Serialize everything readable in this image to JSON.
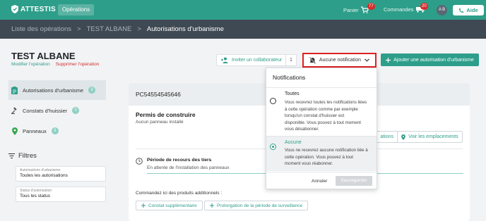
{
  "topbar": {
    "logo_text": "ATTESTIS",
    "nav_active": "Opérations",
    "cart_label": "Panier",
    "cart_count": "77",
    "orders_label": "Commandes",
    "orders_count": "20",
    "avatar_initials": "A B",
    "help_label": "Aide"
  },
  "breadcrumb": {
    "items": [
      "Liste des opérations",
      "TEST ALBANE",
      "Autorisations d'urbanisme"
    ],
    "separator": ">"
  },
  "header": {
    "title": "TEST ALBANE",
    "edit_link": "Modifier l'opération",
    "delete_link": "Supprimer l'opération",
    "invite_label": "Inviter un collaborateur",
    "collaborator_count": "1",
    "notification_label": "Aucune notification",
    "add_button": "Ajouter une autorisation d'urbanisme"
  },
  "sidebar": {
    "items": [
      {
        "label": "Autorisations d'urbanisme",
        "count": "3"
      },
      {
        "label": "Constats d'huissier",
        "count": "0"
      },
      {
        "label": "Panneaux",
        "count": "3"
      }
    ],
    "filters_title": "Filtres",
    "filters": [
      {
        "label": "Autorisations d'urbanisme",
        "value": "Toutes les autorisations"
      },
      {
        "label": "Status d'autorisation",
        "value": "Tous les status"
      }
    ]
  },
  "card": {
    "id": "PC54554545646",
    "permis_title": "Permis de construire",
    "permis_sub": "Aucun panneau installé",
    "partial_button": "ations",
    "locations_button": "Voir les emplacements",
    "periode_title": "Période de recours des tiers",
    "periode_sub": "En attente de l'installation des panneaux",
    "additional_text": "Commandez ici des produits additionnels :",
    "products": [
      "Constat supplémentaire",
      "Prolongation de la période de surveillance"
    ]
  },
  "dropdown": {
    "title": "Notifications",
    "options": [
      {
        "title": "Toutes",
        "lines": [
          "Vous recevrez toutes les notifications liées",
          "à cette opération comme par exemple",
          "lorsqu'un constat d'huissier est",
          "disponible. Vous pouvez à tout moment",
          "vous désabonner."
        ],
        "selected": false
      },
      {
        "title": "Aucune",
        "lines": [
          "Vous ne recevrez aucune notification liée à",
          "cette opération. Vous pouvez à tout",
          "moment vous réabonner."
        ],
        "selected": true
      }
    ],
    "cancel_label": "Annuler",
    "save_label": "Sauvegarder"
  },
  "colors": {
    "brand": "#2d9e8a",
    "breadcrumb_bg": "#3f4953",
    "highlight_border": "#e02020",
    "badge_red": "#d62b2b"
  }
}
